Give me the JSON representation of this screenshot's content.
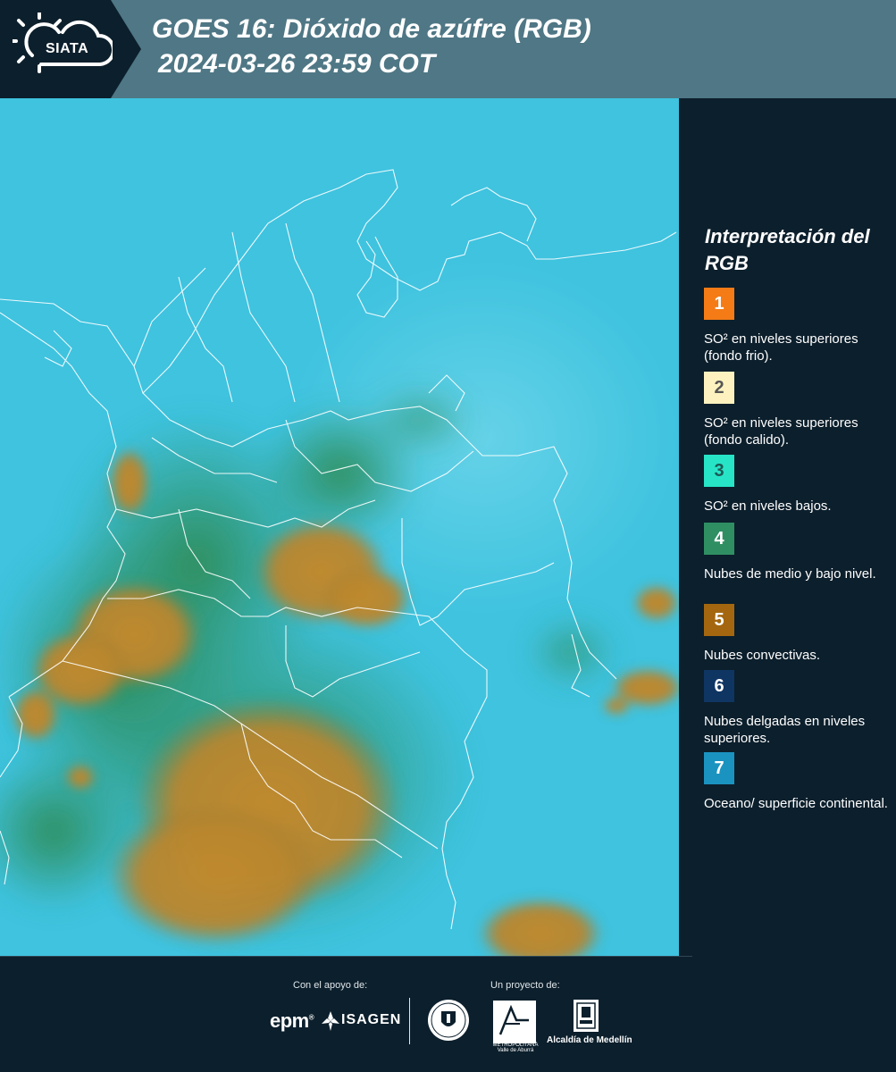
{
  "header": {
    "logo_text": "SIATA",
    "title": "GOES 16: Dióxido de azúfre (RGB)",
    "subtitle": " 2024-03-26 23:59 COT"
  },
  "map": {
    "ocean_color": "#3fc3df",
    "cloud_color": "#b9892e",
    "vegetation_color": "#2f8a5a",
    "border_color": "#ffffff"
  },
  "legend": {
    "title": "Interpretación del RGB",
    "items": [
      {
        "number": "1",
        "label": "SO² en niveles superiores (fondo frio).",
        "color": "#f47b16",
        "text_color": "#ffffff"
      },
      {
        "number": "2",
        "label": "SO² en niveles superiores (fondo calido).",
        "color": "#fdf2bf",
        "text_color": "#555555"
      },
      {
        "number": "3",
        "label": "SO² en niveles bajos.",
        "color": "#27e4c7",
        "text_color": "#1b5a54"
      },
      {
        "number": "4",
        "label": "Nubes de medio y bajo nivel.",
        "color": "#2f8f63",
        "text_color": "#ffffff"
      },
      {
        "number": "5",
        "label": "Nubes convectivas.",
        "color": "#a4670f",
        "text_color": "#ffffff"
      },
      {
        "number": "6",
        "label": "Nubes delgadas en niveles superiores.",
        "color": "#0f3563",
        "text_color": "#ffffff"
      },
      {
        "number": "7",
        "label": "Oceano/ superficie continental.",
        "color": "#1b93c0",
        "text_color": "#ffffff"
      }
    ]
  },
  "footer": {
    "support_label": "Con el apoyo de:",
    "project_label": "Un proyecto de:",
    "epm": "epm",
    "isagen": "ISAGEN",
    "area_metropolitana": "METROPOLITANA Valle de Aburrá",
    "alcaldia": "Alcaldía de Medellín"
  }
}
